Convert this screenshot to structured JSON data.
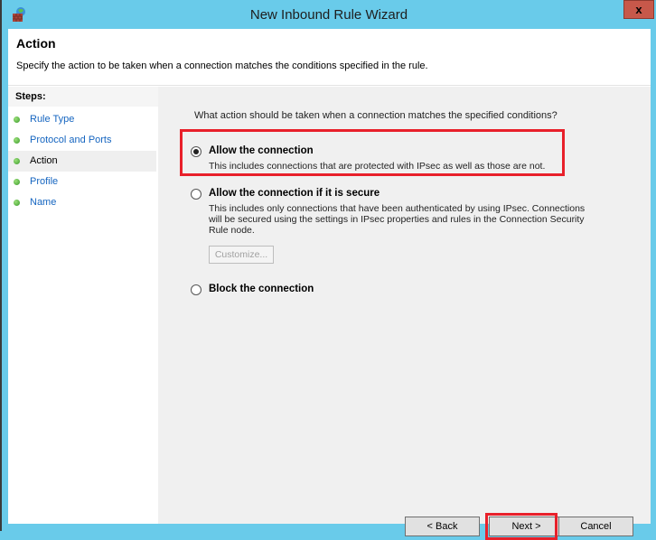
{
  "window": {
    "title": "New Inbound Rule Wizard",
    "close_label": "x",
    "icon": "firewall-icon"
  },
  "header": {
    "title": "Action",
    "description": "Specify the action to be taken when a connection matches the conditions specified in the rule."
  },
  "steps": {
    "title": "Steps:",
    "items": [
      {
        "label": "Rule Type",
        "active": false
      },
      {
        "label": "Protocol and Ports",
        "active": false
      },
      {
        "label": "Action",
        "active": true
      },
      {
        "label": "Profile",
        "active": false
      },
      {
        "label": "Name",
        "active": false
      }
    ]
  },
  "main": {
    "question": "What action should be taken when a connection matches the specified conditions?",
    "options": [
      {
        "label": "Allow the connection",
        "description": "This includes connections that are protected with IPsec as well as those are not.",
        "selected": true
      },
      {
        "label": "Allow the connection if it is secure",
        "description": "This includes only connections that have been authenticated by using IPsec.  Connections will be secured using the settings in IPsec properties and rules in the Connection Security Rule node.",
        "selected": false
      },
      {
        "label": "Block the connection",
        "description": "",
        "selected": false
      }
    ],
    "customize_label": "Customize..."
  },
  "buttons": {
    "back": "< Back",
    "next": "Next >",
    "cancel": "Cancel"
  },
  "colors": {
    "title_bar": "#69cbea",
    "highlight": "#e8202a",
    "close_button": "#c7584a",
    "step_link": "#1565c0"
  }
}
